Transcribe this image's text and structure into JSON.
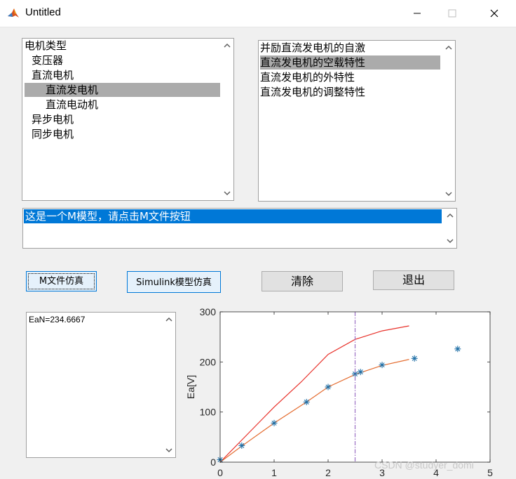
{
  "window": {
    "title": "Untitled"
  },
  "tree_list": {
    "items": [
      {
        "label": "电机类型",
        "indent": 0,
        "selected": false
      },
      {
        "label": "变压器",
        "indent": 1,
        "selected": false
      },
      {
        "label": "直流电机",
        "indent": 1,
        "selected": false
      },
      {
        "label": "直流发电机",
        "indent": 2,
        "selected": true
      },
      {
        "label": "直流电动机",
        "indent": 2,
        "selected": false
      },
      {
        "label": "异步电机",
        "indent": 1,
        "selected": false
      },
      {
        "label": "同步电机",
        "indent": 1,
        "selected": false
      }
    ]
  },
  "experiment_list": {
    "items": [
      {
        "label": "并励直流发电机的自激",
        "selected": false
      },
      {
        "label": "直流发电机的空载特性",
        "selected": true
      },
      {
        "label": "直流发电机的外特性",
        "selected": false
      },
      {
        "label": "直流发电机的调整特性",
        "selected": false
      }
    ]
  },
  "message_box": {
    "text": "这是一个M模型，请点击M文件按钮"
  },
  "buttons": {
    "m_sim": "M文件仿真",
    "simulink_sim": "Simulink模型仿真",
    "clear": "清除",
    "exit": "退出"
  },
  "output_box": {
    "text": "EaN=234.6667"
  },
  "watermark": "CSDN @studyer_domi",
  "colors": {
    "selection_blue": "#0078d7",
    "list_selection_gray": "#ababab",
    "curve_red": "#e8312a",
    "curve_orange": "#e46b2e",
    "marker_blue": "#1f6fa6",
    "vline_purple": "#9b6fc4"
  },
  "chart_data": {
    "type": "line",
    "title": "",
    "xlabel": "",
    "ylabel": "Ea[V]",
    "xlim": [
      0,
      5
    ],
    "ylim": [
      0,
      300
    ],
    "xticks": [
      "0",
      "1",
      "2",
      "3",
      "4",
      "5"
    ],
    "yticks": [
      "0",
      "100",
      "200",
      "300"
    ],
    "grid": false,
    "series": [
      {
        "style": "line",
        "color": "#e8312a",
        "x": [
          0,
          0.5,
          1.0,
          1.5,
          2.0,
          2.5,
          3.0,
          3.5
        ],
        "y": [
          0,
          55,
          110,
          160,
          215,
          245,
          262,
          272
        ]
      },
      {
        "style": "line",
        "color": "#e46b2e",
        "x": [
          0,
          0.4,
          1.0,
          1.6,
          2.0,
          2.5,
          3.0,
          3.5
        ],
        "y": [
          0,
          32,
          78,
          120,
          150,
          175,
          193,
          205
        ]
      },
      {
        "style": "markers",
        "marker": "asterisk",
        "color": "#1f6fa6",
        "x": [
          0,
          0.4,
          1.0,
          1.6,
          2.0,
          2.5,
          2.6,
          3.0,
          3.6,
          4.4
        ],
        "y": [
          5,
          33,
          78,
          120,
          150,
          176,
          180,
          194,
          207,
          226
        ]
      },
      {
        "style": "vline",
        "color": "#9b6fc4",
        "x": [
          2.5
        ]
      }
    ]
  }
}
